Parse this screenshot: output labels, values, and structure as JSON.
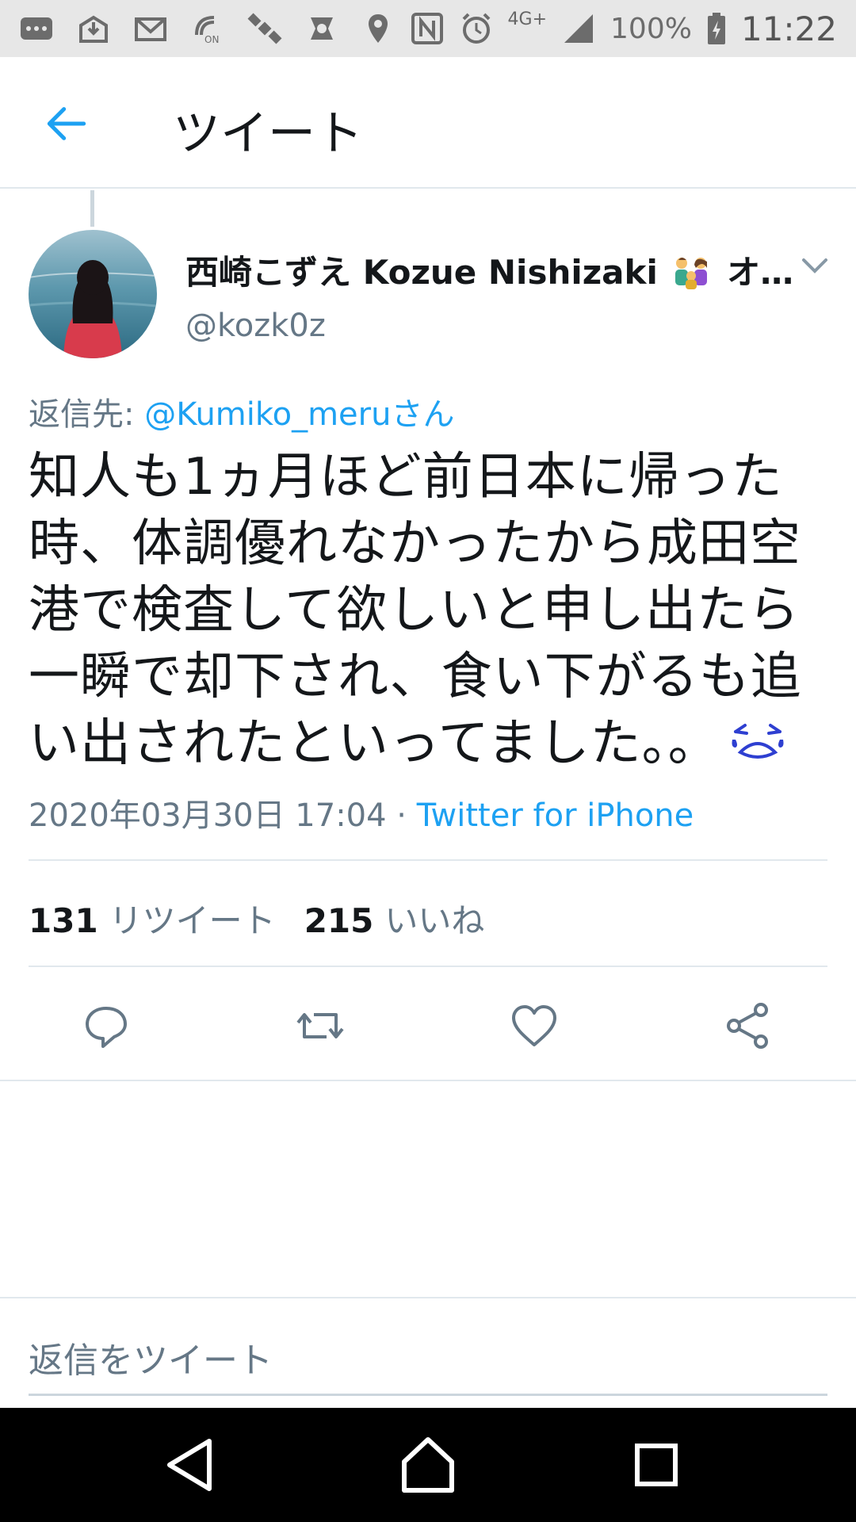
{
  "status_bar": {
    "network_label": "4G+",
    "battery_text": "100%",
    "clock": "11:22",
    "icons": [
      "more-icon",
      "download-mail-icon",
      "mail-icon",
      "nfc-on-icon",
      "satellite-icon",
      "vpn-icon",
      "location-icon",
      "nfc-icon",
      "alarm-icon",
      "signal-icon",
      "battery-charging-icon"
    ]
  },
  "header": {
    "title": "ツイート"
  },
  "tweet": {
    "author_name": "西崎こずえ Kozue Nishizaki",
    "author_name_suffix": "オ…",
    "handle": "@kozk0z",
    "reply_prefix": "返信先: ",
    "reply_to": "@Kumiko_meruさん",
    "lines": [
      "知人も1ヵ月ほど前日本に帰った",
      "時、体調優れなかったから成田空",
      "港で検査して欲しいと申し出たら",
      "一瞬で却下され、食い下がるも追",
      "い出されたといってました。。"
    ],
    "timestamp": "2020年03月30日 17:04 · ",
    "source": "Twitter for iPhone"
  },
  "stats": {
    "retweets_count": "131",
    "retweets_label": "リツイート",
    "likes_count": "215",
    "likes_label": "いいね"
  },
  "reply_box": {
    "placeholder": "返信をツイート"
  },
  "colors": {
    "accent": "#1da1f2",
    "secondary_text": "#657786",
    "divider": "#e1e8ed",
    "status_bar_bg": "#e7e7e7"
  }
}
